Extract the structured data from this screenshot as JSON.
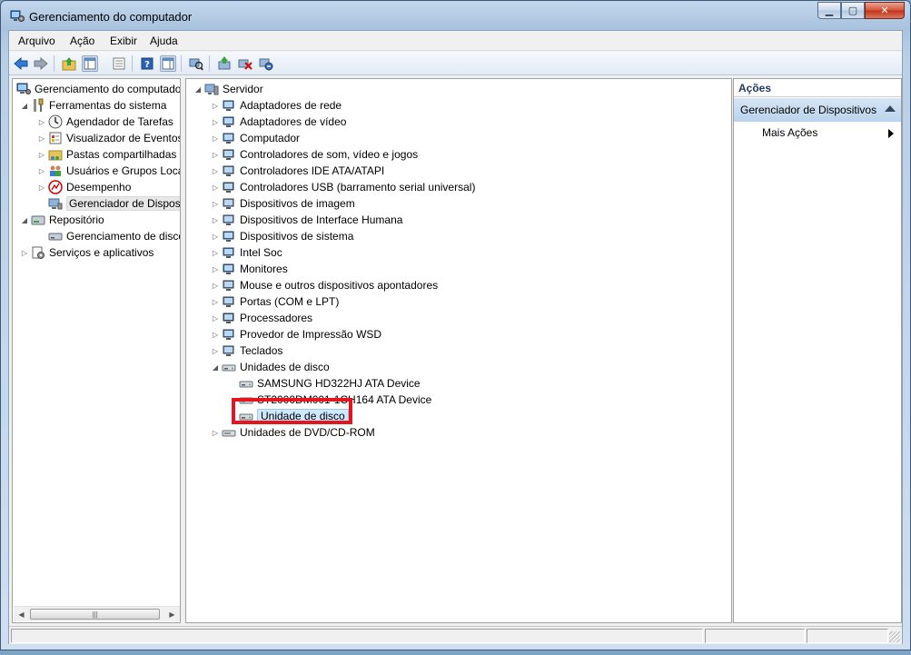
{
  "window": {
    "title": "Gerenciamento do computador"
  },
  "menu": [
    "Arquivo",
    "Ação",
    "Exibir",
    "Ajuda"
  ],
  "toolbar": {
    "icons": [
      "back-arrow-icon",
      "forward-arrow-icon",
      "up-folder-icon",
      "show-hide-tree-icon",
      "properties-icon",
      "help-icon",
      "show-hide-action-pane-icon",
      "scan-hardware-icon",
      "update-driver-icon",
      "uninstall-device-icon",
      "disable-device-icon"
    ]
  },
  "left_tree": {
    "root": "Gerenciamento do computador",
    "items": [
      {
        "label": "Ferramentas do sistema",
        "icon": "tools-icon",
        "level": 1,
        "expander": "expanded"
      },
      {
        "label": "Agendador de Tarefas",
        "icon": "clock-icon",
        "level": 2,
        "expander": "collapsed"
      },
      {
        "label": "Visualizador de Eventos",
        "icon": "event-viewer-icon",
        "level": 2,
        "expander": "collapsed"
      },
      {
        "label": "Pastas compartilhadas",
        "icon": "shared-folder-icon",
        "level": 2,
        "expander": "collapsed"
      },
      {
        "label": "Usuários e Grupos Loca",
        "icon": "users-icon",
        "level": 2,
        "expander": "collapsed"
      },
      {
        "label": "Desempenho",
        "icon": "performance-icon",
        "level": 2,
        "expander": "collapsed"
      },
      {
        "label": "Gerenciador de Disposit",
        "icon": "device-manager-icon",
        "level": 2,
        "expander": "none",
        "selected": true
      },
      {
        "label": "Repositório",
        "icon": "storage-icon",
        "level": 1,
        "expander": "expanded"
      },
      {
        "label": "Gerenciamento de disco",
        "icon": "disk-management-icon",
        "level": 2,
        "expander": "none"
      },
      {
        "label": "Serviços e aplicativos",
        "icon": "services-icon",
        "level": 1,
        "expander": "collapsed"
      }
    ]
  },
  "device_tree": {
    "root": "Servidor",
    "categories": [
      "Adaptadores de rede",
      "Adaptadores de vídeo",
      "Computador",
      "Controladores de som, vídeo e jogos",
      "Controladores IDE ATA/ATAPI",
      "Controladores USB (barramento serial universal)",
      "Dispositivos de imagem",
      "Dispositivos de Interface Humana",
      "Dispositivos de sistema",
      "Intel Soc",
      "Monitores",
      "Mouse e outros dispositivos apontadores",
      "Portas (COM e LPT)",
      "Processadores",
      "Provedor de Impressão WSD",
      "Teclados"
    ],
    "expanded_category": "Unidades de disco",
    "disk_devices": [
      "SAMSUNG HD322HJ ATA Device",
      "ST2000DM001-1CH164 ATA Device",
      "Unidade de disco"
    ],
    "last_category": "Unidades de DVD/CD-ROM",
    "highlighted_item": "Unidade de disco"
  },
  "actions": {
    "header": "Ações",
    "section": "Gerenciador de Dispositivos",
    "more": "Mais Ações"
  },
  "colors": {
    "highlight_box": "#e3151f",
    "selection_blue": "#cde8ff",
    "actions_section": "#c8dcf1"
  }
}
